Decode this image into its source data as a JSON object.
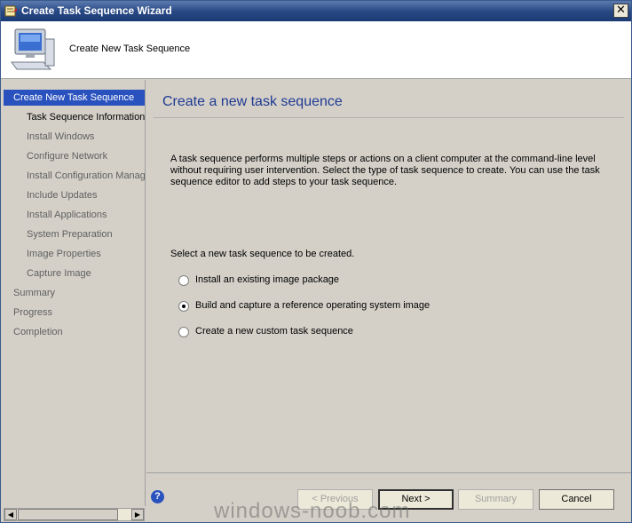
{
  "window": {
    "title": "Create Task Sequence Wizard",
    "close_glyph": "✕"
  },
  "header": {
    "title": "Create New Task Sequence",
    "icon": "computer-icon"
  },
  "sidebar": {
    "items": [
      {
        "label": "Create New Task Sequence",
        "state": "active"
      },
      {
        "label": "Task Sequence Information",
        "state": "current"
      },
      {
        "label": "Install Windows"
      },
      {
        "label": "Configure Network"
      },
      {
        "label": "Install Configuration Manag"
      },
      {
        "label": "Include Updates"
      },
      {
        "label": "Install Applications"
      },
      {
        "label": "System Preparation"
      },
      {
        "label": "Image Properties"
      },
      {
        "label": "Capture Image"
      },
      {
        "label": "Summary"
      },
      {
        "label": "Progress"
      },
      {
        "label": "Completion"
      }
    ]
  },
  "main": {
    "title": "Create a new task sequence",
    "description": "A task sequence performs multiple steps or actions on a client computer at the command-line level without requiring user intervention. Select the type of task sequence to create. You can use the task sequence editor to add steps to your task sequence.",
    "prompt": "Select a new task sequence to be created.",
    "options": [
      {
        "label": "Install an existing image package",
        "checked": false
      },
      {
        "label": "Build and capture a reference operating system image",
        "checked": true
      },
      {
        "label": "Create a new custom task sequence",
        "checked": false
      }
    ]
  },
  "footer": {
    "help_glyph": "?",
    "previous_label": "< Previous",
    "next_label": "Next >",
    "summary_label": "Summary",
    "cancel_label": "Cancel"
  },
  "watermark": "windows-noob.com",
  "colors": {
    "accent": "#2a52be",
    "title_blue": "#1f3a93"
  }
}
